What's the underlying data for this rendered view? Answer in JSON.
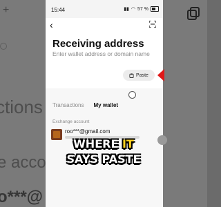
{
  "background": {
    "text_ctions": "ctions",
    "text_accou": "e accou",
    "text_email": "o***@"
  },
  "status_bar": {
    "time": "15:44",
    "battery": "57 %"
  },
  "header": {
    "title": "Receiving address"
  },
  "address_input": {
    "value": "",
    "placeholder": "Enter wallet address or domain name"
  },
  "paste_button": {
    "label": "Paste"
  },
  "tabs": [
    {
      "label": "Transactions",
      "active": false
    },
    {
      "label": "My wallet",
      "active": true
    }
  ],
  "exchange_section": {
    "label": "Exchange account",
    "account_email": "roo***@gmail.com"
  },
  "caption": {
    "word1": "WHERE",
    "word2": "IT",
    "line2": "SAYS PASTE"
  },
  "colors": {
    "arrow": "#e01818",
    "caption_highlight": "#ffd21f"
  }
}
